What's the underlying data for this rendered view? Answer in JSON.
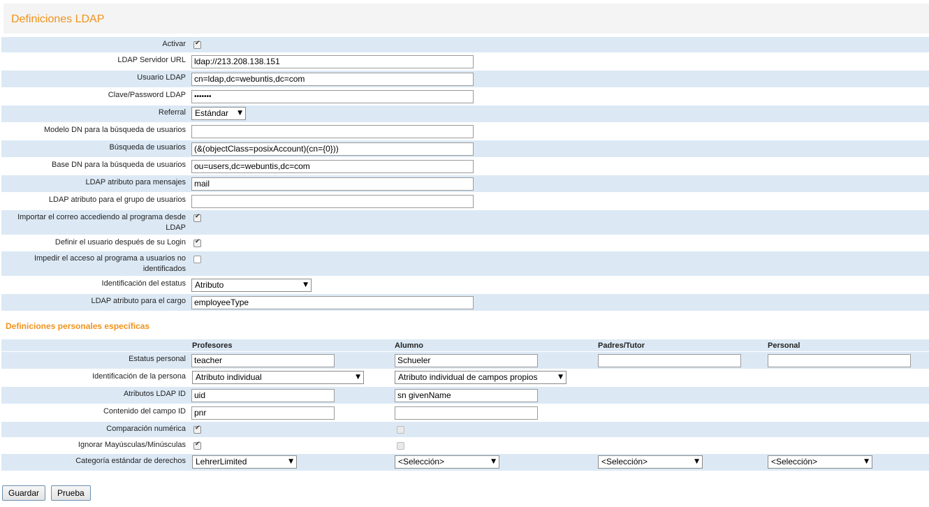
{
  "page_title": "Definiciones LDAP",
  "ldap": {
    "activar": {
      "label": "Activar",
      "checked": true
    },
    "server_url": {
      "label": "LDAP Servidor URL",
      "value": "ldap://213.208.138.151"
    },
    "usuario": {
      "label": "Usuario LDAP",
      "value": "cn=ldap,dc=webuntis,dc=com"
    },
    "clave": {
      "label": "Clave/Password LDAP",
      "value": "•••••••"
    },
    "referral": {
      "label": "Referral",
      "value": "Estándar"
    },
    "modelo_dn": {
      "label": "Modelo DN para la búsqueda de usuarios",
      "value": ""
    },
    "busqueda": {
      "label": "Búsqueda de usuarios",
      "value": "(&(objectClass=posixAccount)(cn={0}))"
    },
    "base_dn": {
      "label": "Base DN para la búsqueda de usuarios",
      "value": "ou=users,dc=webuntis,dc=com"
    },
    "atributo_mensajes": {
      "label": "LDAP atributo para mensajes",
      "value": "mail"
    },
    "atributo_grupo": {
      "label": "LDAP atributo para el grupo de usuarios",
      "value": ""
    },
    "importar_correo": {
      "label_line1": "Importar el correo accediendo al programa desde",
      "label_line2": "LDAP",
      "checked": true
    },
    "definir_usuario": {
      "label": "Definir el usuario después de su Login",
      "checked": true
    },
    "impedir_acceso": {
      "label_line1": "Impedir el acceso al programa a usuarios no",
      "label_line2": "identificados",
      "checked": false
    },
    "identificacion_estatus": {
      "label": "Identificación del estatus",
      "value": "Atributo"
    },
    "atributo_cargo": {
      "label": "LDAP atributo para el cargo",
      "value": "employeeType"
    }
  },
  "personal": {
    "section_title": "Definiciones personales específicas",
    "columns": [
      "Profesores",
      "Alumno",
      "Padres/Tutor",
      "Personal"
    ],
    "estatus": {
      "label": "Estatus personal",
      "values": [
        "teacher",
        "Schueler",
        "",
        ""
      ]
    },
    "identificacion": {
      "label": "Identificación de la persona",
      "values": [
        "Atributo individual",
        "Atributo individual de campos propios"
      ]
    },
    "atributos_id": {
      "label": "Atributos LDAP ID",
      "values": [
        "uid",
        "sn givenName"
      ]
    },
    "contenido_id": {
      "label": "Contenido del campo ID",
      "values": [
        "pnr",
        ""
      ]
    },
    "comparacion": {
      "label": "Comparación numérica",
      "checked": [
        true,
        false
      ]
    },
    "ignorar": {
      "label": "Ignorar Mayúsculas/Minúsculas",
      "checked": [
        true,
        false
      ]
    },
    "categoria": {
      "label": "Categoría estándar de derechos",
      "values": [
        "LehrerLimited",
        "<Selección>",
        "<Selección>",
        "<Selección>"
      ]
    }
  },
  "buttons": {
    "guardar": "Guardar",
    "prueba": "Prueba"
  }
}
